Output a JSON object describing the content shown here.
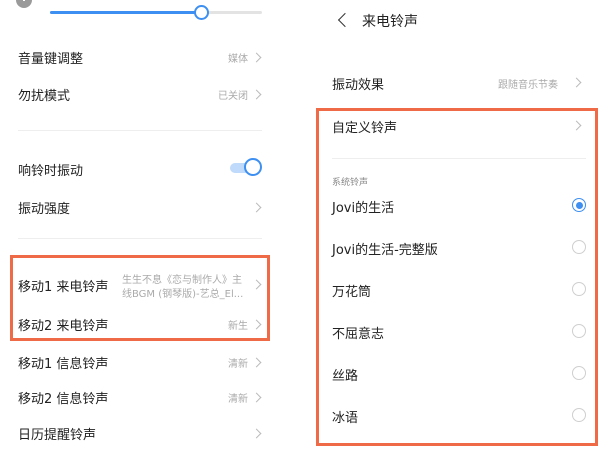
{
  "left": {
    "rows": [
      {
        "label": "音量键调整",
        "value": "媒体"
      },
      {
        "label": "勿扰模式",
        "value": "已关闭"
      },
      {
        "label": "响铃时振动",
        "toggle": "on"
      },
      {
        "label": "振动强度",
        "value": ""
      },
      {
        "label": "移动1 来电铃声",
        "value_lines": [
          "生生不息《恋与制作人》主",
          "线BGM (钢琴版)-艺总_El..."
        ]
      },
      {
        "label": "移动2 来电铃声",
        "value": "新生"
      },
      {
        "label": "移动1 信息铃声",
        "value": "清新"
      },
      {
        "label": "移动2 信息铃声",
        "value": "清新"
      },
      {
        "label": "日历提醒铃声",
        "value": ""
      }
    ],
    "slider_level": 0.71
  },
  "right": {
    "title": "来电铃声",
    "vibration": {
      "label": "振动效果",
      "value": "跟随音乐节奏"
    },
    "custom": {
      "label": "自定义铃声"
    },
    "section_label": "系统铃声",
    "ringtones": [
      {
        "label": "Jovi的生活",
        "selected": true
      },
      {
        "label": "Jovi的生活-完整版",
        "selected": false
      },
      {
        "label": "万花筒",
        "selected": false
      },
      {
        "label": "不屈意志",
        "selected": false
      },
      {
        "label": "丝路",
        "selected": false
      },
      {
        "label": "冰语",
        "selected": false
      }
    ]
  },
  "colors": {
    "accent": "#3d8ff2",
    "highlight": "#ef6b47"
  }
}
